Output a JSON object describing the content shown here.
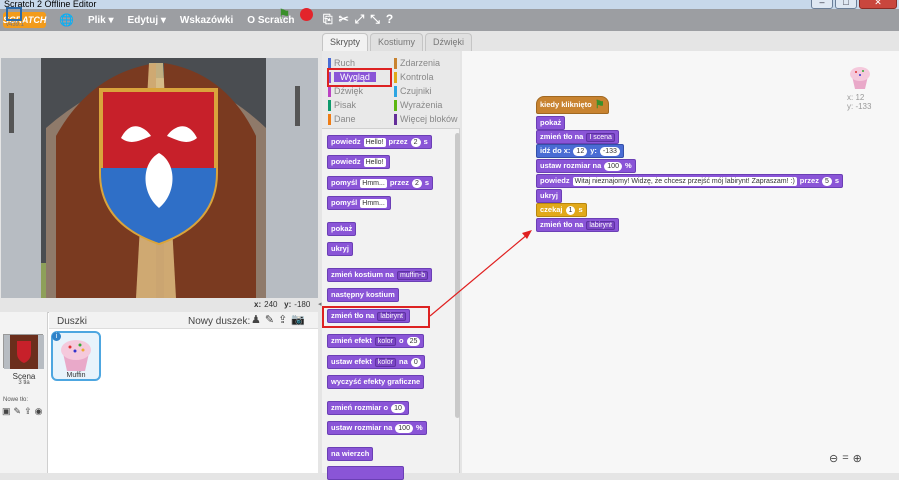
{
  "window": {
    "title": "Scratch 2 Offline Editor"
  },
  "menubar": {
    "logo": "SCRATCH",
    "items": [
      "Plik ▾",
      "Edytuj ▾",
      "Wskazówki",
      "O Scratch"
    ]
  },
  "stage": {
    "version": "v439.1",
    "x_label": "x:",
    "x_value": "240",
    "y_label": "y:",
    "y_value": "-180"
  },
  "sprites_pane": {
    "title": "Duszki",
    "new_sprite_label": "Nowy duszek:",
    "stage_name": "Scena",
    "stage_sub": "3 tła",
    "new_backdrop_label": "Nowe tło:",
    "sprite_name": "Muffin"
  },
  "tabs": [
    "Skrypty",
    "Kostiumy",
    "Dźwięki"
  ],
  "categories": {
    "left": [
      "Ruch",
      "Wygląd",
      "Dźwięk",
      "Pisak",
      "Dane"
    ],
    "right": [
      "Zdarzenia",
      "Kontrola",
      "Czujniki",
      "Wyrażenia",
      "Więcej bloków"
    ]
  },
  "palette": {
    "b1": {
      "a": "powiedz",
      "f": "Hello!",
      "b": "przez",
      "n": "2",
      "c": "s"
    },
    "b2": {
      "a": "powiedz",
      "f": "Hello!"
    },
    "b3": {
      "a": "pomyśl",
      "f": "Hmm...",
      "b": "przez",
      "n": "2",
      "c": "s"
    },
    "b4": {
      "a": "pomyśl",
      "f": "Hmm..."
    },
    "b5": "pokaż",
    "b6": "ukryj",
    "b7": {
      "a": "zmień kostium na",
      "d": "muffin-b"
    },
    "b8": "następny kostium",
    "b9": {
      "a": "zmień tło na",
      "d": "labirynt"
    },
    "b10": {
      "a": "zmień efekt",
      "d": "kolor",
      "b": "o",
      "n": "25"
    },
    "b11": {
      "a": "ustaw efekt",
      "d": "kolor",
      "b": "na",
      "n": "0"
    },
    "b12": "wyczyść efekty graficzne",
    "b13": {
      "a": "zmień rozmiar o",
      "n": "10"
    },
    "b14": {
      "a": "ustaw rozmiar na",
      "n": "100",
      "c": "%"
    },
    "b15": "na wierzch"
  },
  "script": {
    "hat": "kiedy kliknięto",
    "s1": "pokaż",
    "s2": {
      "a": "zmień tło na",
      "d": "I scena"
    },
    "s3": {
      "a": "idź do x:",
      "x": "12",
      "b": "y:",
      "y": "-133"
    },
    "s4": {
      "a": "ustaw rozmiar na",
      "n": "100",
      "c": "%"
    },
    "s5": {
      "a": "powiedz",
      "f": "Witaj nieznajomy! Widzę, że chcesz przejść mój labirynt! Zapraszam! :)",
      "b": "przez",
      "n": "5",
      "c": "s"
    },
    "s6": "ukryj",
    "s7": {
      "a": "czekaj",
      "n": "1",
      "c": "s"
    },
    "s8": {
      "a": "zmień tło na",
      "d": "labirynt"
    }
  },
  "sprite_info": {
    "x": "x: 12",
    "y": "y: -133"
  },
  "colors": {
    "looks": "#8a55d7",
    "motion": "#4a6cd4",
    "control": "#e1a91a",
    "events": "#c88330",
    "highlight": "#dd2222"
  }
}
